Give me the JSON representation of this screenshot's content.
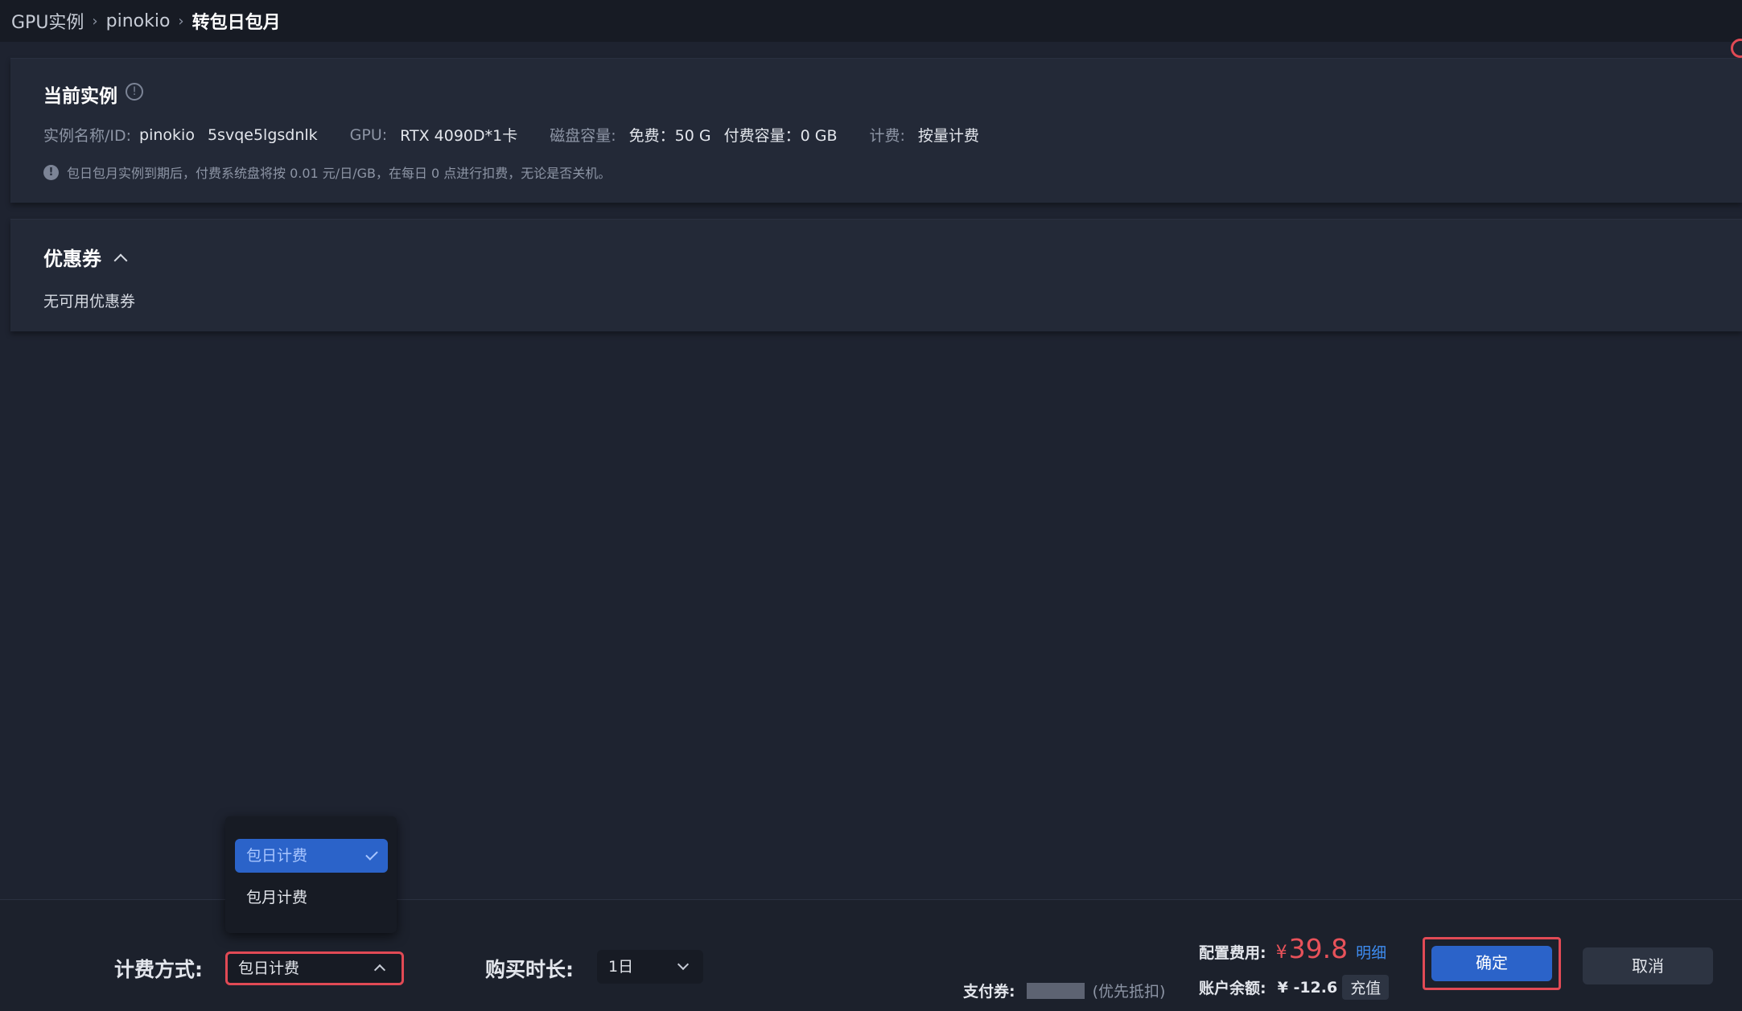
{
  "breadcrumb": {
    "items": [
      "GPU实例",
      "pinokio",
      "转包日包月"
    ]
  },
  "current_instance": {
    "title": "当前实例",
    "name_label": "实例名称/ID:",
    "name_value": "pinokio",
    "id_value": "5svqe5lgsdnlk",
    "gpu_label": "GPU:",
    "gpu_value": "RTX 4090D*1卡",
    "disk_label": "磁盘容量:",
    "disk_free": "免费：50 G",
    "disk_paid": "付费容量：0 GB",
    "billing_label": "计费:",
    "billing_value": "按量计费",
    "notice": "包日包月实例到期后，付费系统盘将按 0.01 元/日/GB，在每日 0 点进行扣费，无论是否关机。"
  },
  "coupon": {
    "title": "优惠券",
    "empty_text": "无可用优惠券"
  },
  "billing_dropdown": {
    "options": [
      "包日计费",
      "包月计费"
    ],
    "selected": "包日计费"
  },
  "footer": {
    "billing_label": "计费方式:",
    "billing_value": "包日计费",
    "duration_label": "购买时长:",
    "duration_value": "1日",
    "voucher_label": "支付券:",
    "voucher_hint": "(优先抵扣)",
    "cost_label": "配置费用:",
    "cost_currency": "¥",
    "cost_amount": "39.8",
    "cost_detail": "明细",
    "balance_label": "账户余额:",
    "balance_value": "¥ -12.6",
    "recharge_label": "充值",
    "confirm_label": "确定",
    "cancel_label": "取消"
  },
  "colors": {
    "accent": "#2b63c9",
    "price": "#e8525a",
    "highlight_border": "#e14a55",
    "link": "#3e8cf0"
  }
}
